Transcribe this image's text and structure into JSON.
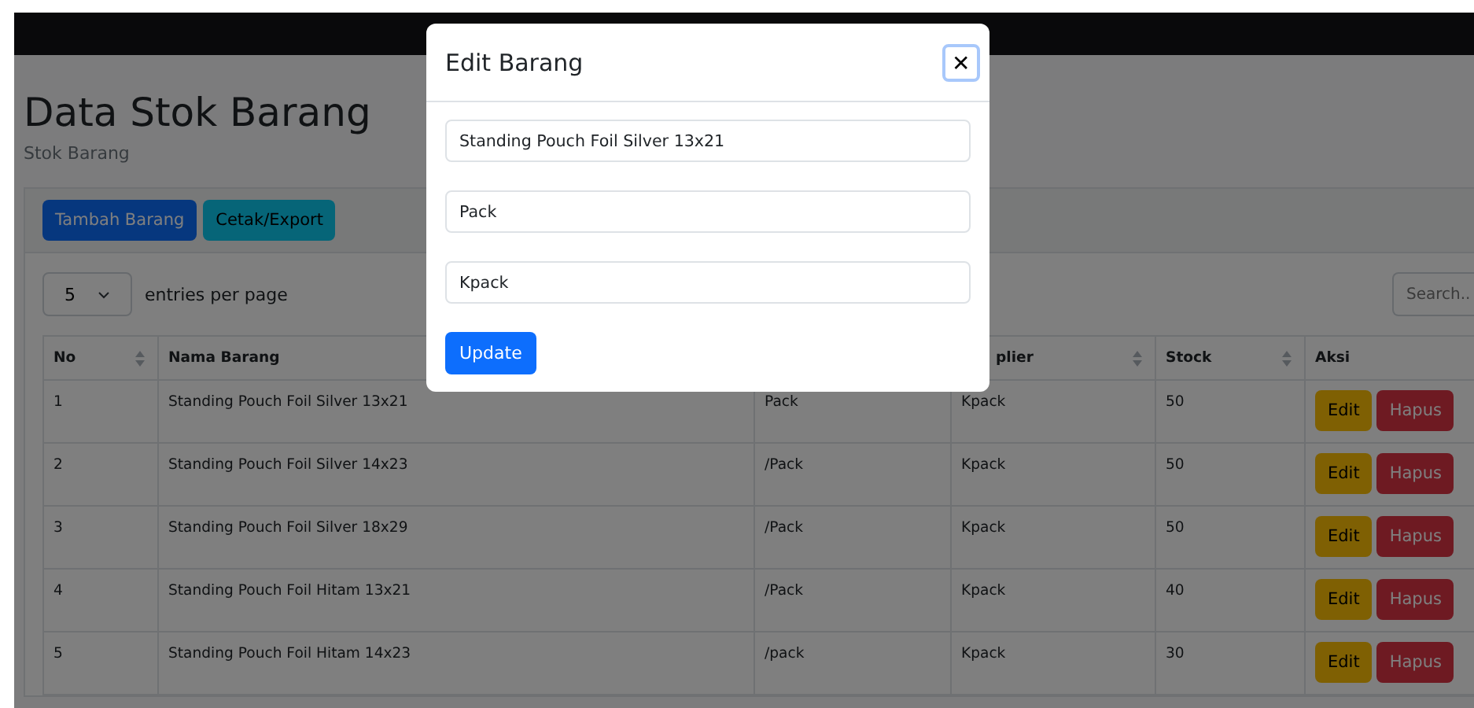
{
  "page": {
    "title": "Data Stok Barang",
    "subtitle": "Stok Barang"
  },
  "toolbar": {
    "buttons": [
      {
        "label": "Tambah Barang",
        "kind": "primary"
      },
      {
        "label": "Cetak/Export",
        "kind": "info"
      }
    ]
  },
  "entries": {
    "value": "5",
    "label": "entries per page"
  },
  "search": {
    "placeholder": "Search.."
  },
  "table": {
    "columns": [
      {
        "label": "No",
        "sortable": true
      },
      {
        "label": "Nama Barang"
      },
      {},
      {
        "label": "plier",
        "sortable": true
      },
      {
        "label": "Stock",
        "sortable": true
      },
      {
        "label": "Aksi"
      }
    ],
    "rows": [
      {
        "no": "1",
        "name": "Standing Pouch Foil Silver 13x21",
        "unit": "Pack",
        "supplier": "Kpack",
        "stock": "50",
        "actions": [
          {
            "label": "Edit",
            "kind": "warning"
          },
          {
            "label": "Hapus",
            "kind": "danger"
          }
        ]
      },
      {
        "no": "2",
        "name": "Standing Pouch Foil Silver 14x23",
        "unit": "/Pack",
        "supplier": "Kpack",
        "stock": "50",
        "actions": [
          {
            "label": "Edit",
            "kind": "warning"
          },
          {
            "label": "Hapus",
            "kind": "danger"
          }
        ]
      },
      {
        "no": "3",
        "name": "Standing Pouch Foil Silver 18x29",
        "unit": "/Pack",
        "supplier": "Kpack",
        "stock": "50",
        "actions": [
          {
            "label": "Edit",
            "kind": "warning"
          },
          {
            "label": "Hapus",
            "kind": "danger"
          }
        ]
      },
      {
        "no": "4",
        "name": "Standing Pouch Foil Hitam 13x21",
        "unit": "/Pack",
        "supplier": "Kpack",
        "stock": "40",
        "actions": [
          {
            "label": "Edit",
            "kind": "warning"
          },
          {
            "label": "Hapus",
            "kind": "danger"
          }
        ]
      },
      {
        "no": "5",
        "name": "Standing Pouch Foil Hitam 14x23",
        "unit": "/pack",
        "supplier": "Kpack",
        "stock": "30",
        "actions": [
          {
            "label": "Edit",
            "kind": "warning"
          },
          {
            "label": "Hapus",
            "kind": "danger"
          }
        ]
      }
    ]
  },
  "modal": {
    "title": "Edit Barang",
    "close": "✕",
    "fields": [
      {
        "value": "Standing Pouch Foil Silver 13x21"
      },
      {
        "value": "Pack"
      },
      {
        "value": "Kpack"
      }
    ],
    "submit": "Update"
  }
}
